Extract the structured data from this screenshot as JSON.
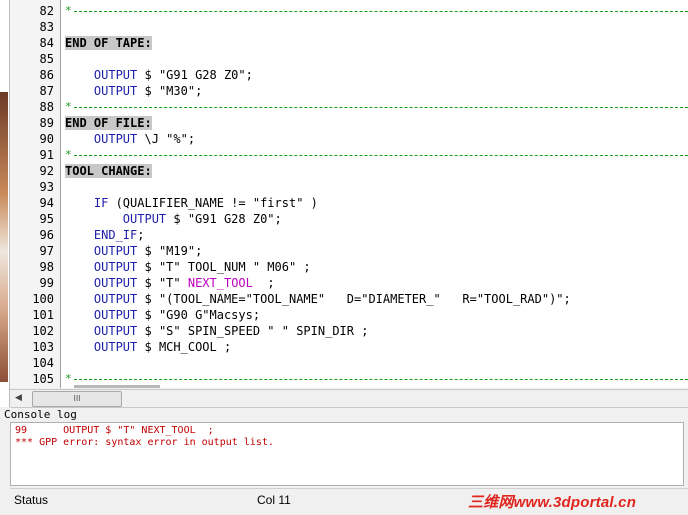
{
  "editor": {
    "lines": [
      {
        "num": "82",
        "text": "*",
        "type": "divider"
      },
      {
        "num": "83",
        "text": "",
        "type": "blank"
      },
      {
        "num": "84",
        "text": "END OF TAPE:",
        "type": "label"
      },
      {
        "num": "85",
        "text": "",
        "type": "blank"
      },
      {
        "num": "86",
        "kw": "OUTPUT",
        "rest": " $ \"G91 G28 Z0\";",
        "type": "code",
        "indent": "    "
      },
      {
        "num": "87",
        "kw": "OUTPUT",
        "rest": " $ \"M30\";",
        "type": "code",
        "indent": "    "
      },
      {
        "num": "88",
        "text": "*",
        "type": "divider"
      },
      {
        "num": "89",
        "text": "END OF FILE:",
        "type": "label"
      },
      {
        "num": "90",
        "kw": "OUTPUT",
        "rest": " \\J \"%\";",
        "type": "code",
        "indent": "    "
      },
      {
        "num": "91",
        "text": "*",
        "type": "divider"
      },
      {
        "num": "92",
        "text": "TOOL CHANGE:",
        "type": "label"
      },
      {
        "num": "93",
        "text": "",
        "type": "blank"
      },
      {
        "num": "94",
        "kw": "IF",
        "rest": " (QUALIFIER_NAME != \"first\" )",
        "type": "code",
        "indent": "    "
      },
      {
        "num": "95",
        "kw": "OUTPUT",
        "rest": " $ \"G91 G28 Z0\";",
        "type": "code",
        "indent": "        "
      },
      {
        "num": "96",
        "kw": "END_IF",
        "rest": ";",
        "type": "code",
        "indent": "    "
      },
      {
        "num": "97",
        "kw": "OUTPUT",
        "rest": " $ \"M19\";",
        "type": "code",
        "indent": "    "
      },
      {
        "num": "98",
        "kw": "OUTPUT",
        "rest": " $ \"T\" TOOL_NUM \" M06\" ;",
        "type": "code",
        "indent": "    "
      },
      {
        "num": "99",
        "kw": "OUTPUT",
        "rest": " $ \"T\" ",
        "magenta": "NEXT_TOOL",
        "rest2": "  ;",
        "type": "code",
        "indent": "    "
      },
      {
        "num": "100",
        "kw": "OUTPUT",
        "rest": " $ \"(TOOL_NAME=\"TOOL_NAME\"   D=\"DIAMETER_\"   R=\"TOOL_RAD\")\";",
        "type": "code",
        "indent": "    "
      },
      {
        "num": "101",
        "kw": "OUTPUT",
        "rest": " $ \"G90 G\"Macsys;",
        "type": "code",
        "indent": "    "
      },
      {
        "num": "102",
        "kw": "OUTPUT",
        "rest": " $ \"S\" SPIN_SPEED \" \" SPIN_DIR ;",
        "type": "code",
        "indent": "    "
      },
      {
        "num": "103",
        "kw": "OUTPUT",
        "rest": " $ MCH_COOL ;",
        "type": "code",
        "indent": "    "
      },
      {
        "num": "104",
        "text": "",
        "type": "blank"
      },
      {
        "num": "105",
        "text": "*",
        "type": "divider"
      }
    ]
  },
  "hscroll": {
    "left_arrow": "◀",
    "thumb_grip": "III"
  },
  "console": {
    "title": "Console log",
    "lines": [
      "99      OUTPUT $ \"T\" NEXT_TOOL  ;",
      "*** GPP error: syntax error in output list."
    ]
  },
  "statusbar": {
    "status_label": "Status",
    "col_label": "Col 11"
  },
  "watermark": {
    "text": "三维网www.3dportal.cn"
  },
  "colors": {
    "keyword": "#1e1eaa",
    "error": "#c00000",
    "divider": "#1a9a1a",
    "highlight": "#c8c8c8",
    "magenta": "#c000c0"
  }
}
